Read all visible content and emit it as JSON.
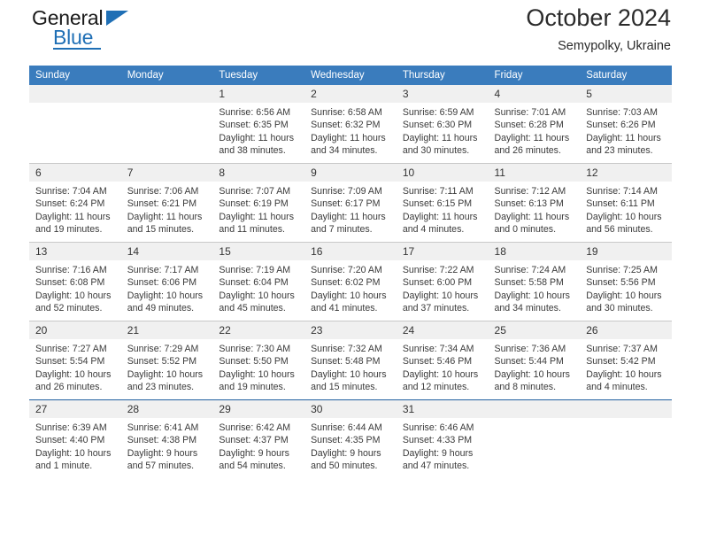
{
  "brand": {
    "name_top": "General",
    "name_bottom": "Blue"
  },
  "header": {
    "title": "October 2024",
    "subtitle": "Semypolky, Ukraine"
  },
  "calendar": {
    "weekday_headers": [
      "Sunday",
      "Monday",
      "Tuesday",
      "Wednesday",
      "Thursday",
      "Friday",
      "Saturday"
    ],
    "accent_color": "#3a7cbd",
    "weeks": [
      [
        {
          "day": "",
          "lines": []
        },
        {
          "day": "",
          "lines": []
        },
        {
          "day": "1",
          "lines": [
            "Sunrise: 6:56 AM",
            "Sunset: 6:35 PM",
            "Daylight: 11 hours",
            "and 38 minutes."
          ]
        },
        {
          "day": "2",
          "lines": [
            "Sunrise: 6:58 AM",
            "Sunset: 6:32 PM",
            "Daylight: 11 hours",
            "and 34 minutes."
          ]
        },
        {
          "day": "3",
          "lines": [
            "Sunrise: 6:59 AM",
            "Sunset: 6:30 PM",
            "Daylight: 11 hours",
            "and 30 minutes."
          ]
        },
        {
          "day": "4",
          "lines": [
            "Sunrise: 7:01 AM",
            "Sunset: 6:28 PM",
            "Daylight: 11 hours",
            "and 26 minutes."
          ]
        },
        {
          "day": "5",
          "lines": [
            "Sunrise: 7:03 AM",
            "Sunset: 6:26 PM",
            "Daylight: 11 hours",
            "and 23 minutes."
          ]
        }
      ],
      [
        {
          "day": "6",
          "lines": [
            "Sunrise: 7:04 AM",
            "Sunset: 6:24 PM",
            "Daylight: 11 hours",
            "and 19 minutes."
          ]
        },
        {
          "day": "7",
          "lines": [
            "Sunrise: 7:06 AM",
            "Sunset: 6:21 PM",
            "Daylight: 11 hours",
            "and 15 minutes."
          ]
        },
        {
          "day": "8",
          "lines": [
            "Sunrise: 7:07 AM",
            "Sunset: 6:19 PM",
            "Daylight: 11 hours",
            "and 11 minutes."
          ]
        },
        {
          "day": "9",
          "lines": [
            "Sunrise: 7:09 AM",
            "Sunset: 6:17 PM",
            "Daylight: 11 hours",
            "and 7 minutes."
          ]
        },
        {
          "day": "10",
          "lines": [
            "Sunrise: 7:11 AM",
            "Sunset: 6:15 PM",
            "Daylight: 11 hours",
            "and 4 minutes."
          ]
        },
        {
          "day": "11",
          "lines": [
            "Sunrise: 7:12 AM",
            "Sunset: 6:13 PM",
            "Daylight: 11 hours",
            "and 0 minutes."
          ]
        },
        {
          "day": "12",
          "lines": [
            "Sunrise: 7:14 AM",
            "Sunset: 6:11 PM",
            "Daylight: 10 hours",
            "and 56 minutes."
          ]
        }
      ],
      [
        {
          "day": "13",
          "lines": [
            "Sunrise: 7:16 AM",
            "Sunset: 6:08 PM",
            "Daylight: 10 hours",
            "and 52 minutes."
          ]
        },
        {
          "day": "14",
          "lines": [
            "Sunrise: 7:17 AM",
            "Sunset: 6:06 PM",
            "Daylight: 10 hours",
            "and 49 minutes."
          ]
        },
        {
          "day": "15",
          "lines": [
            "Sunrise: 7:19 AM",
            "Sunset: 6:04 PM",
            "Daylight: 10 hours",
            "and 45 minutes."
          ]
        },
        {
          "day": "16",
          "lines": [
            "Sunrise: 7:20 AM",
            "Sunset: 6:02 PM",
            "Daylight: 10 hours",
            "and 41 minutes."
          ]
        },
        {
          "day": "17",
          "lines": [
            "Sunrise: 7:22 AM",
            "Sunset: 6:00 PM",
            "Daylight: 10 hours",
            "and 37 minutes."
          ]
        },
        {
          "day": "18",
          "lines": [
            "Sunrise: 7:24 AM",
            "Sunset: 5:58 PM",
            "Daylight: 10 hours",
            "and 34 minutes."
          ]
        },
        {
          "day": "19",
          "lines": [
            "Sunrise: 7:25 AM",
            "Sunset: 5:56 PM",
            "Daylight: 10 hours",
            "and 30 minutes."
          ]
        }
      ],
      [
        {
          "day": "20",
          "lines": [
            "Sunrise: 7:27 AM",
            "Sunset: 5:54 PM",
            "Daylight: 10 hours",
            "and 26 minutes."
          ]
        },
        {
          "day": "21",
          "lines": [
            "Sunrise: 7:29 AM",
            "Sunset: 5:52 PM",
            "Daylight: 10 hours",
            "and 23 minutes."
          ]
        },
        {
          "day": "22",
          "lines": [
            "Sunrise: 7:30 AM",
            "Sunset: 5:50 PM",
            "Daylight: 10 hours",
            "and 19 minutes."
          ]
        },
        {
          "day": "23",
          "lines": [
            "Sunrise: 7:32 AM",
            "Sunset: 5:48 PM",
            "Daylight: 10 hours",
            "and 15 minutes."
          ]
        },
        {
          "day": "24",
          "lines": [
            "Sunrise: 7:34 AM",
            "Sunset: 5:46 PM",
            "Daylight: 10 hours",
            "and 12 minutes."
          ]
        },
        {
          "day": "25",
          "lines": [
            "Sunrise: 7:36 AM",
            "Sunset: 5:44 PM",
            "Daylight: 10 hours",
            "and 8 minutes."
          ]
        },
        {
          "day": "26",
          "lines": [
            "Sunrise: 7:37 AM",
            "Sunset: 5:42 PM",
            "Daylight: 10 hours",
            "and 4 minutes."
          ]
        }
      ],
      [
        {
          "day": "27",
          "lines": [
            "Sunrise: 6:39 AM",
            "Sunset: 4:40 PM",
            "Daylight: 10 hours",
            "and 1 minute."
          ]
        },
        {
          "day": "28",
          "lines": [
            "Sunrise: 6:41 AM",
            "Sunset: 4:38 PM",
            "Daylight: 9 hours",
            "and 57 minutes."
          ]
        },
        {
          "day": "29",
          "lines": [
            "Sunrise: 6:42 AM",
            "Sunset: 4:37 PM",
            "Daylight: 9 hours",
            "and 54 minutes."
          ]
        },
        {
          "day": "30",
          "lines": [
            "Sunrise: 6:44 AM",
            "Sunset: 4:35 PM",
            "Daylight: 9 hours",
            "and 50 minutes."
          ]
        },
        {
          "day": "31",
          "lines": [
            "Sunrise: 6:46 AM",
            "Sunset: 4:33 PM",
            "Daylight: 9 hours",
            "and 47 minutes."
          ]
        },
        {
          "day": "",
          "lines": []
        },
        {
          "day": "",
          "lines": []
        }
      ]
    ]
  }
}
